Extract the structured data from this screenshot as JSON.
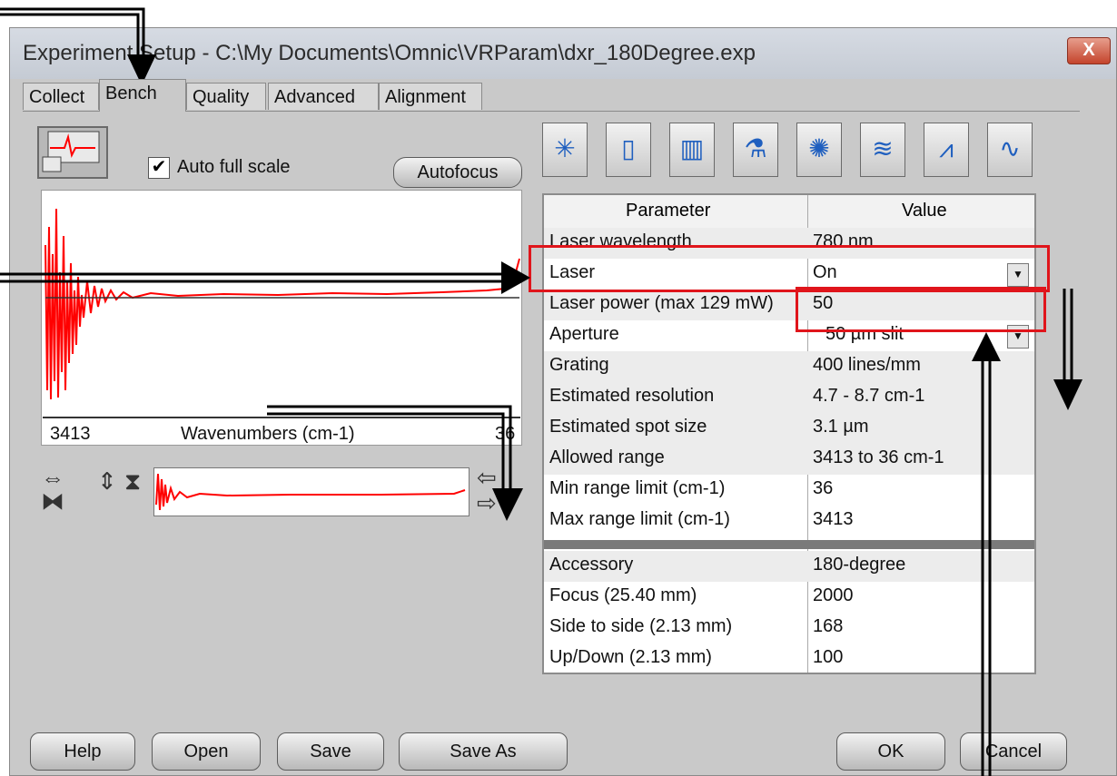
{
  "window": {
    "title": "Experiment Setup - C:\\My Documents\\Omnic\\VRParam\\dxr_180Degree.exp",
    "close_label": "X"
  },
  "tabs": [
    {
      "label": "Collect"
    },
    {
      "label": "Bench"
    },
    {
      "label": "Quality"
    },
    {
      "label": "Advanced"
    },
    {
      "label": "Alignment"
    }
  ],
  "bench": {
    "auto_full_scale_label": "Auto full scale",
    "auto_full_scale_checked": "✔",
    "autofocus_label": "Autofocus",
    "x_start": "3413",
    "x_axis_label": "Wavenumbers (cm-1)",
    "x_end": "36"
  },
  "grid": {
    "header_parameter": "Parameter",
    "header_value": "Value",
    "rows": [
      {
        "param": "Laser wavelength",
        "value": "780 nm"
      },
      {
        "param": "Laser",
        "value": "On"
      },
      {
        "param": "Laser power (max 129 mW)",
        "value": "50"
      },
      {
        "param": "Aperture",
        "value": "50 µm slit"
      },
      {
        "param": "Grating",
        "value": "400 lines/mm"
      },
      {
        "param": "Estimated resolution",
        "value": "4.7 - 8.7 cm-1"
      },
      {
        "param": "Estimated spot size",
        "value": "3.1 µm"
      },
      {
        "param": "Allowed range",
        "value": "3413 to 36 cm-1"
      },
      {
        "param": "Min range limit (cm-1)",
        "value": "36"
      },
      {
        "param": "Max range limit (cm-1)",
        "value": "3413"
      },
      {
        "param": "Accessory",
        "value": "180-degree"
      },
      {
        "param": "Focus (25.40 mm)",
        "value": "2000"
      },
      {
        "param": "Side to side (2.13 mm)",
        "value": "168"
      },
      {
        "param": "Up/Down (2.13 mm)",
        "value": "100"
      }
    ]
  },
  "toolbar_icons": [
    {
      "icon": "laser-icon",
      "glyph": "✳"
    },
    {
      "icon": "door-icon",
      "glyph": "▯"
    },
    {
      "icon": "grating-icon",
      "glyph": "▥"
    },
    {
      "icon": "sample-icon",
      "glyph": "⚗"
    },
    {
      "icon": "lightbulb-icon",
      "glyph": "✺"
    },
    {
      "icon": "spectra-stack-icon",
      "glyph": "≋"
    },
    {
      "icon": "peaks-icon",
      "glyph": "⩘"
    },
    {
      "icon": "curve-icon",
      "glyph": "∿"
    }
  ],
  "buttons": {
    "help": "Help",
    "open": "Open",
    "save": "Save",
    "save_as": "Save As",
    "ok": "OK",
    "cancel": "Cancel"
  },
  "colors": {
    "spectrum": "#ff0000",
    "highlight_box": "#e0151b"
  }
}
